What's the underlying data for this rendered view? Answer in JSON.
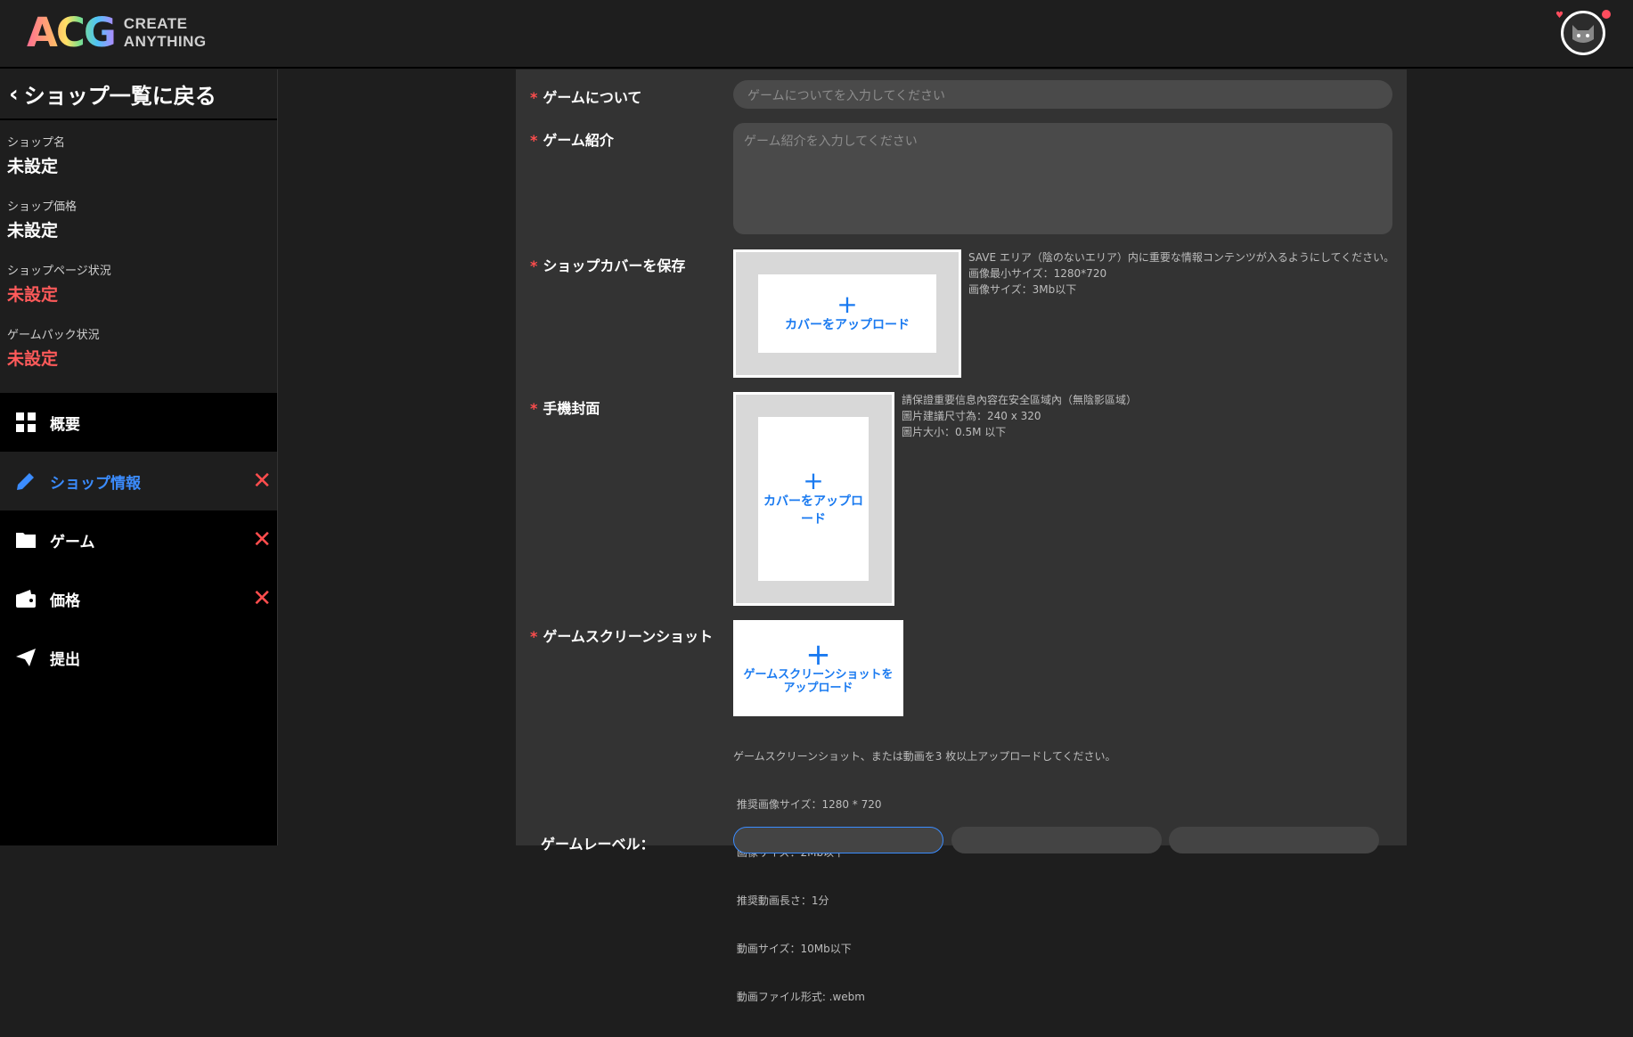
{
  "brand": {
    "logo_mark": "ACG",
    "logo_line1": "CREATE",
    "logo_line2": "ANYTHING"
  },
  "user": {
    "avatar_icon": "cat-avatar-icon"
  },
  "sidebar": {
    "back_label": "ショップ一覧に戻る",
    "status": [
      {
        "label": "ショップ名",
        "value": "未設定",
        "color": "#ffffff"
      },
      {
        "label": "ショップ価格",
        "value": "未設定",
        "color": "#ffffff"
      },
      {
        "label": "ショップページ状況",
        "value": "未設定",
        "color": "#ff5a5a"
      },
      {
        "label": "ゲームパック状況",
        "value": "未設定",
        "color": "#ff5a5a"
      }
    ],
    "nav": [
      {
        "label": "概要",
        "icon": "dashboard-icon",
        "active": false,
        "error": false
      },
      {
        "label": "ショップ情報",
        "icon": "pencil-icon",
        "active": true,
        "error": true
      },
      {
        "label": "ゲーム",
        "icon": "folder-icon",
        "active": false,
        "error": true
      },
      {
        "label": "価格",
        "icon": "wallet-icon",
        "active": false,
        "error": true
      },
      {
        "label": "提出",
        "icon": "send-icon",
        "active": false,
        "error": false
      }
    ],
    "error_mark": "✕"
  },
  "form": {
    "required_mark": "*",
    "about": {
      "label": "ゲームについて",
      "placeholder": "ゲームについてを入力してください"
    },
    "intro": {
      "label": "ゲーム紹介",
      "placeholder": "ゲーム紹介を入力してください"
    },
    "cover": {
      "label": "ショップカバーを保存",
      "upload_label": "カバーをアップロード",
      "hints": [
        "SAVE エリア（陰のないエリア）内に重要な情報コンテンツが入るようにしてください。",
        "画像最小サイズ：1280*720",
        "画像サイズ：3Mb以下"
      ]
    },
    "mobile_cover": {
      "label": "手機封面",
      "upload_label": "カバーをアップロード",
      "hints": [
        "請保證重要信息內容在安全區域內（無陰影區域）",
        "圖片建議尺寸為：240 x 320",
        "圖片大小：0.5M 以下"
      ]
    },
    "screenshots": {
      "label": "ゲームスクリーンショット",
      "upload_label_1": "ゲームスクリーンショットを",
      "upload_label_2": "アップロード",
      "hints": [
        "ゲームスクリーンショット、または動画を3 枚以上アップロードしてください。",
        " 推奨画像サイズ：1280 * 720",
        " 画像サイズ：2Mb以下",
        " 推奨動画長さ：1分",
        " 動画サイズ：10Mb以下",
        " 動画ファイル形式: .webm"
      ]
    },
    "level": {
      "label": "ゲームレーベル："
    }
  }
}
